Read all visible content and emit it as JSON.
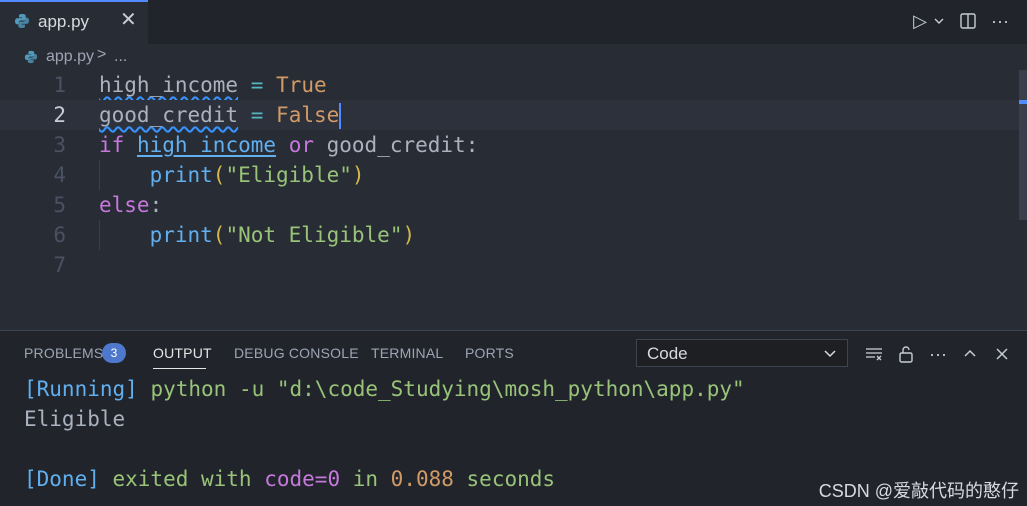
{
  "tabs": [
    {
      "label": "app.py",
      "close": "✕",
      "icon": "python-icon"
    }
  ],
  "tab_actions": {
    "run": "▷",
    "run_menu": "⌵",
    "split": "split-editor-icon",
    "more": "···"
  },
  "breadcrumb": {
    "file": "app.py",
    "separator": ">",
    "more": "..."
  },
  "editor": {
    "line_numbers": [
      "1",
      "2",
      "3",
      "4",
      "5",
      "6",
      "7"
    ],
    "active_line": 2,
    "lines": [
      [
        {
          "t": "high_income",
          "c": "var squiggle"
        },
        {
          "t": " ",
          "c": "var"
        },
        {
          "t": "=",
          "c": "op"
        },
        {
          "t": " ",
          "c": "var"
        },
        {
          "t": "True",
          "c": "const"
        }
      ],
      [
        {
          "t": "good_credit",
          "c": "var squiggle"
        },
        {
          "t": " ",
          "c": "var"
        },
        {
          "t": "=",
          "c": "op"
        },
        {
          "t": " ",
          "c": "var"
        },
        {
          "t": "False",
          "c": "const"
        }
      ],
      [
        {
          "t": "if",
          "c": "kw"
        },
        {
          "t": " ",
          "c": "var"
        },
        {
          "t": "high_income",
          "c": "link"
        },
        {
          "t": " ",
          "c": "var"
        },
        {
          "t": "or",
          "c": "kw"
        },
        {
          "t": " good_credit:",
          "c": "var"
        }
      ],
      [
        {
          "t": "    ",
          "c": "var"
        },
        {
          "t": "print",
          "c": "fn"
        },
        {
          "t": "(",
          "c": "paren"
        },
        {
          "t": "\"Eligible\"",
          "c": "str"
        },
        {
          "t": ")",
          "c": "paren"
        }
      ],
      [
        {
          "t": "else",
          "c": "kw"
        },
        {
          "t": ":",
          "c": "var"
        }
      ],
      [
        {
          "t": "    ",
          "c": "var"
        },
        {
          "t": "print",
          "c": "fn"
        },
        {
          "t": "(",
          "c": "paren"
        },
        {
          "t": "\"Not Eligible\"",
          "c": "str"
        },
        {
          "t": ")",
          "c": "paren"
        }
      ],
      []
    ]
  },
  "panel": {
    "tabs": [
      "PROBLEMS",
      "OUTPUT",
      "DEBUG CONSOLE",
      "TERMINAL",
      "PORTS"
    ],
    "active_tab": "OUTPUT",
    "problems_count": "3",
    "output_channel": "Code",
    "output_lines": [
      [
        {
          "t": "[Running]",
          "c": "blue"
        },
        {
          "t": " python -u \"d:\\code_Studying\\mosh_python\\app.py\"",
          "c": "green"
        }
      ],
      [
        {
          "t": "Eligible",
          "c": "plain"
        }
      ],
      [],
      [
        {
          "t": "[Done]",
          "c": "blue"
        },
        {
          "t": " exited with ",
          "c": "green"
        },
        {
          "t": "code=0",
          "c": "purple"
        },
        {
          "t": " in ",
          "c": "green"
        },
        {
          "t": "0.088",
          "c": "orange"
        },
        {
          "t": " seconds",
          "c": "green"
        }
      ]
    ]
  },
  "watermark": "CSDN @爱敲代码的憨仔",
  "colors": {
    "accent": "#528bff",
    "background": "#282c34",
    "panel": "#21252b"
  }
}
